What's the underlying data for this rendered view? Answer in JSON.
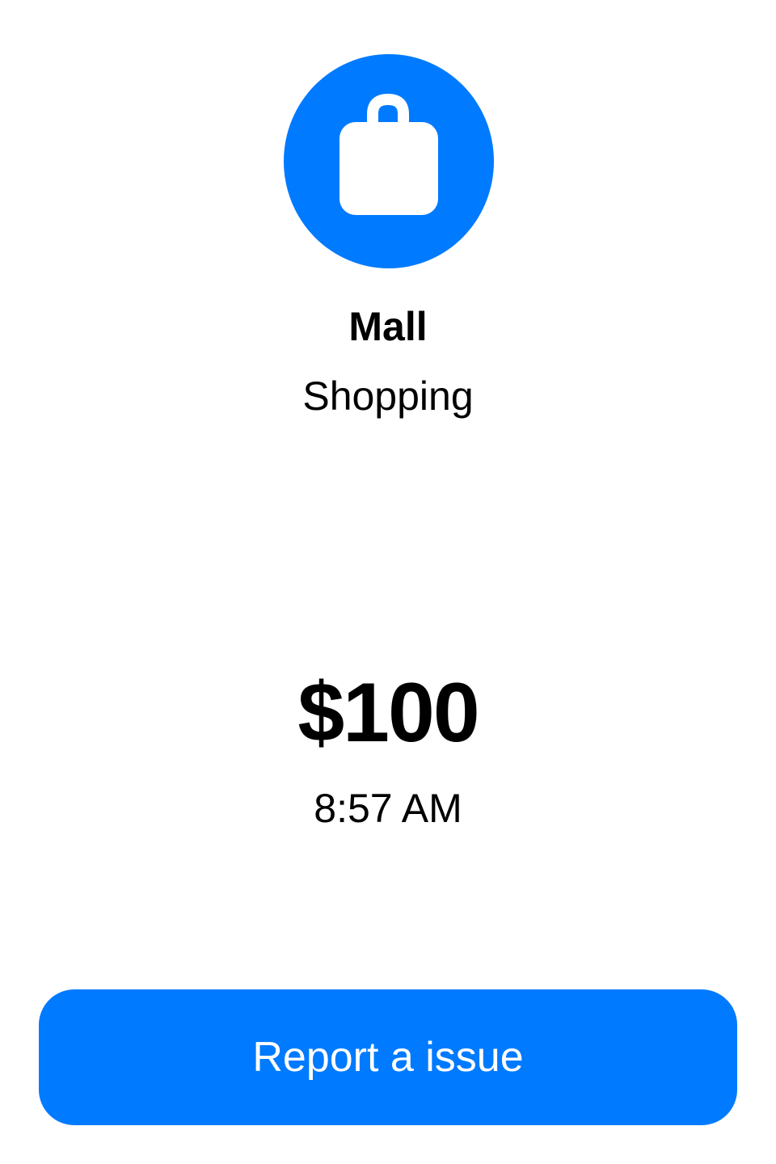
{
  "transaction": {
    "icon": "shopping-bag-icon",
    "merchant": "Mall",
    "category": "Shopping",
    "amount": "$100",
    "time": "8:57 AM"
  },
  "actions": {
    "report_label": "Report a issue"
  },
  "colors": {
    "accent": "#007aff",
    "icon_foreground": "#ffffff",
    "text": "#000000",
    "background": "#ffffff"
  }
}
